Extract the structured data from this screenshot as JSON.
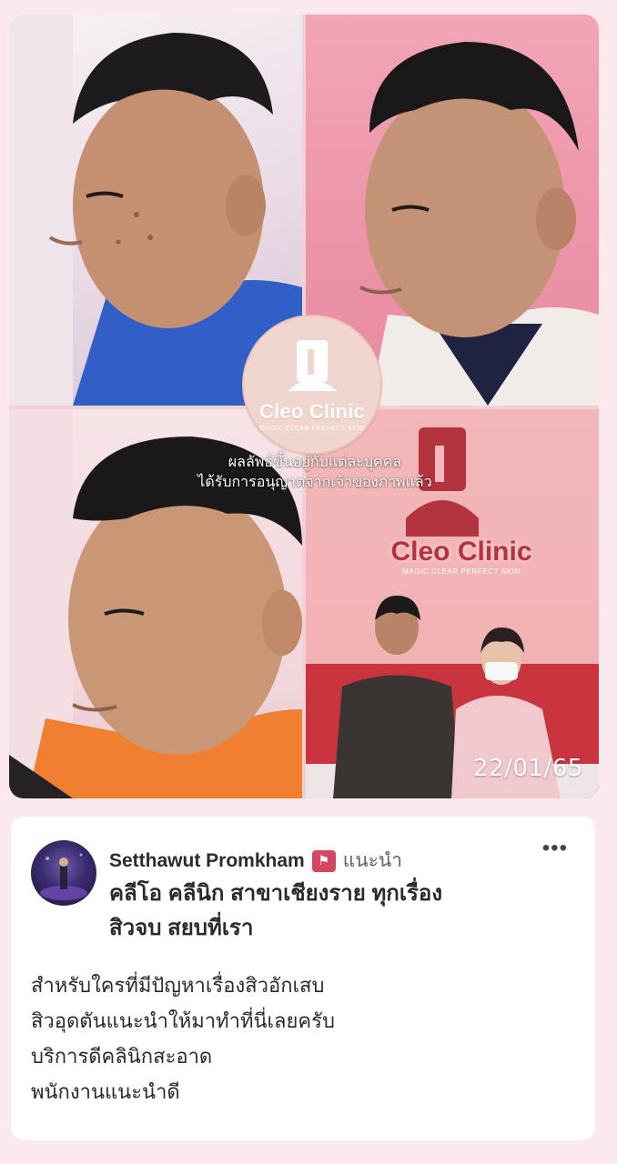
{
  "collage": {
    "logo": {
      "brand": "Cleo Clinic",
      "tagline": "MAGIC CLEAR PERFECT SKIN"
    },
    "disclaimer": [
      "ผลลัพธ์ขึ้นอยู่กับแต่ละบุคคล",
      "ได้รับการอนุญาตจากเจ้าของภาพแล้ว"
    ],
    "wall_sign": {
      "brand": "Cleo Clinic",
      "tagline": "MAGIC CLEAR PERFECT SKIN"
    },
    "date_stamp": "22/01/65"
  },
  "review": {
    "author": "Setthawut Promkham",
    "recommend_icon": "recommend-flag-icon",
    "recommend_label": "แนะนำ",
    "page_name_lines": [
      "คลีโอ คลีนิก สาขาเชียงราย ทุกเรื่อง",
      "สิวจบ สยบที่เรา"
    ],
    "body_lines": [
      "สำหรับใครที่มีปัญหาเรื่องสิวอักเสบ",
      "สิวอุดตันแนะนำให้มาทำที่นี่เลยครับ",
      "บริการดีคลินิกสะอาด",
      "พนักงานแนะนำดี"
    ],
    "more_icon": "more-options-icon"
  },
  "colors": {
    "background": "#fbe9ee",
    "brand_pink": "#d64561",
    "logo_red": "#b3343f"
  }
}
